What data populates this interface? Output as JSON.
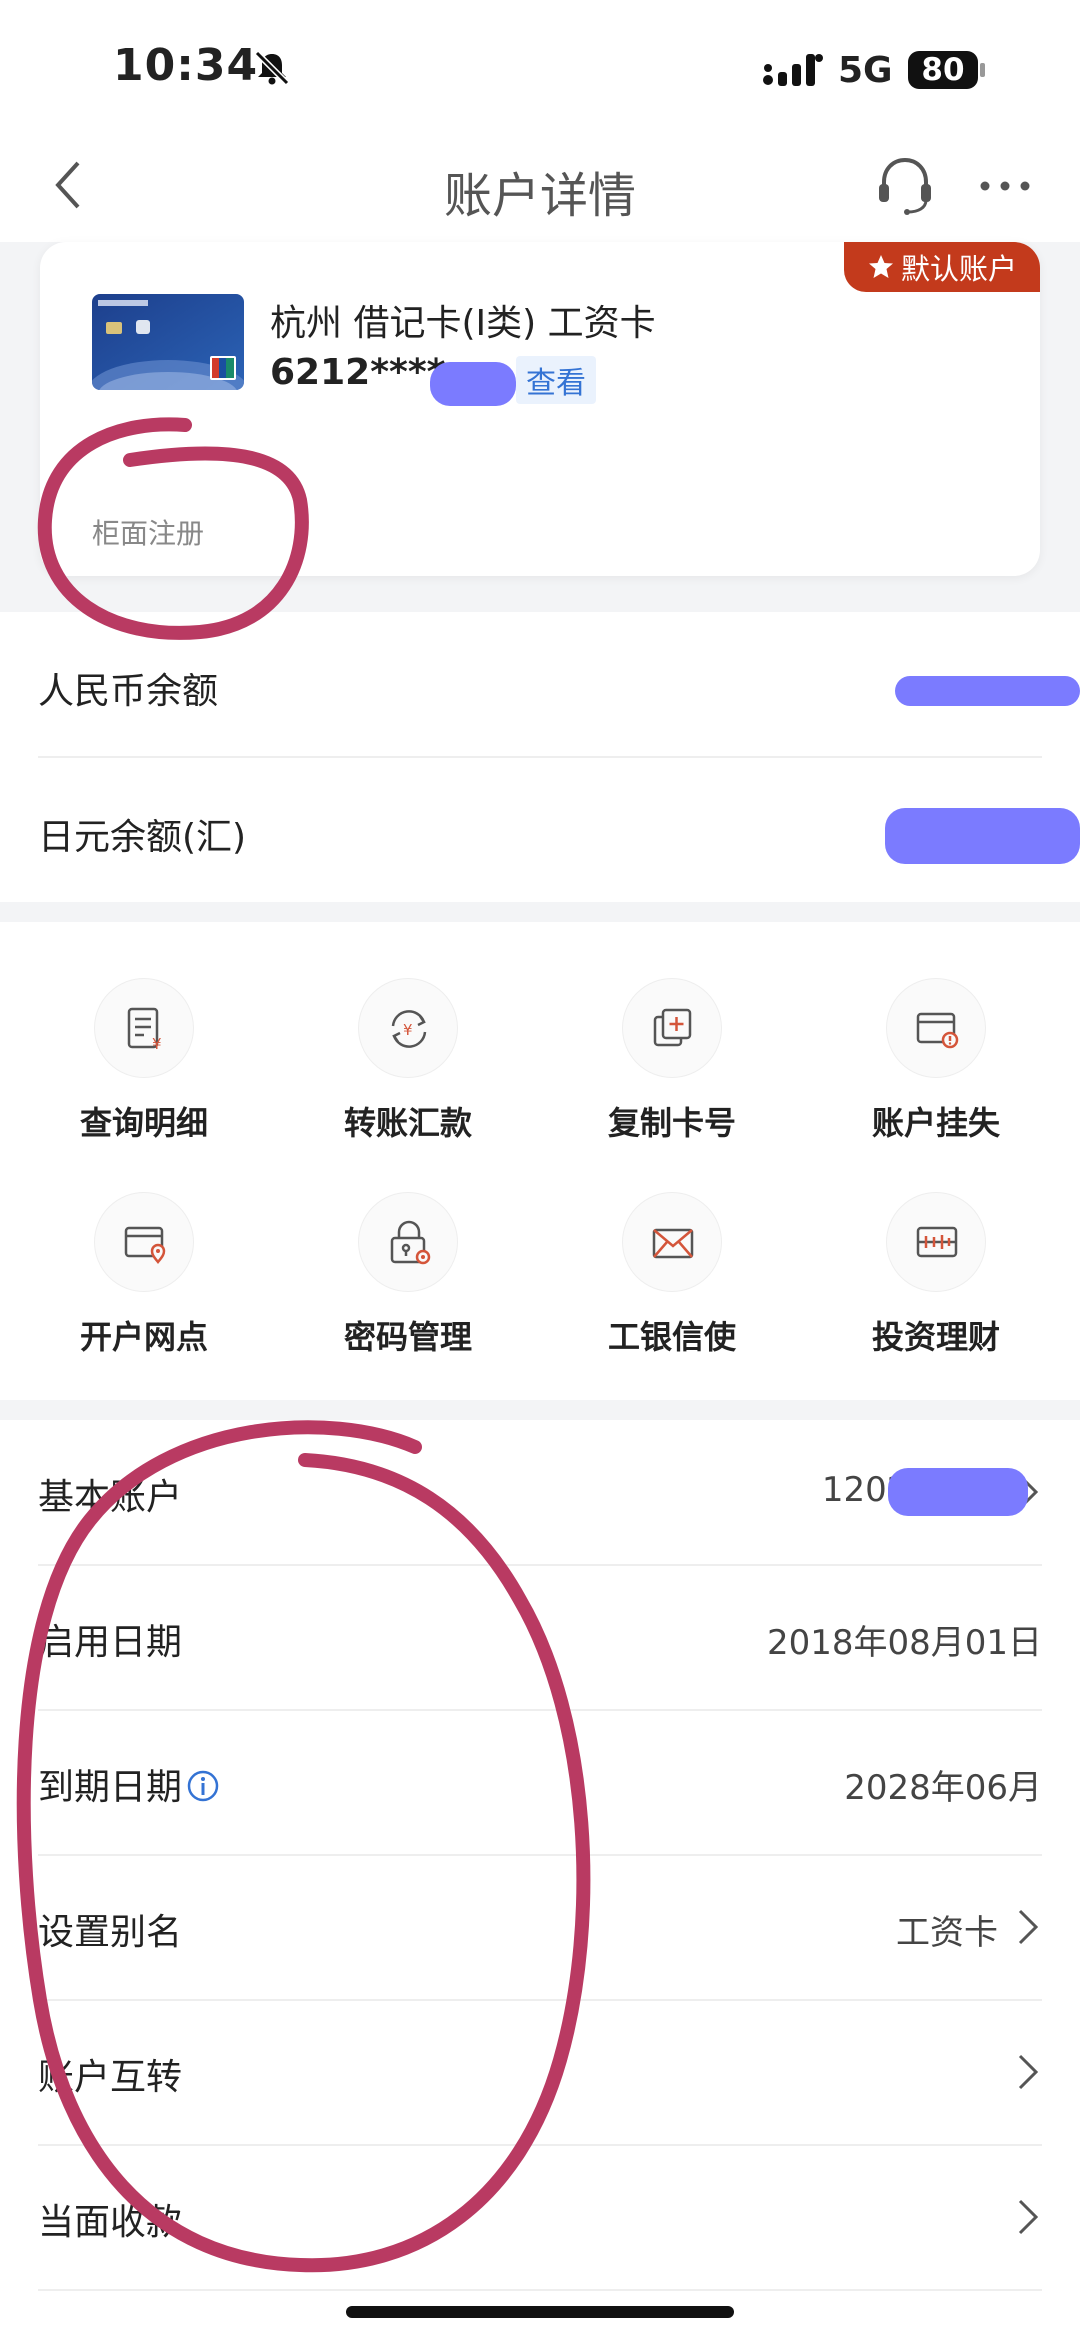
{
  "status_bar": {
    "time": "10:34",
    "network": "5G",
    "battery": "80"
  },
  "header": {
    "title": "账户详情"
  },
  "card": {
    "badge": "默认账户",
    "name": "杭州 借记卡(Ⅰ类) 工资卡",
    "number_masked": "6212****",
    "view_label": "查看",
    "registration": "柜面注册"
  },
  "balances": [
    {
      "label": "人民币余额"
    },
    {
      "label": "日元余额(汇)"
    }
  ],
  "actions": [
    {
      "label": "查询明细",
      "icon": "statement-icon"
    },
    {
      "label": "转账汇款",
      "icon": "transfer-icon"
    },
    {
      "label": "复制卡号",
      "icon": "copy-card-icon"
    },
    {
      "label": "账户挂失",
      "icon": "report-loss-icon"
    },
    {
      "label": "开户网点",
      "icon": "branch-location-icon"
    },
    {
      "label": "密码管理",
      "icon": "password-lock-icon"
    },
    {
      "label": "工银信使",
      "icon": "envelope-icon"
    },
    {
      "label": "投资理财",
      "icon": "investment-icon"
    }
  ],
  "list": [
    {
      "label": "基本账户",
      "value": "1202****3",
      "chevron": true
    },
    {
      "label": "启用日期",
      "value": "2018年08月01日",
      "chevron": false
    },
    {
      "label": "到期日期",
      "value": "2028年06月",
      "chevron": false,
      "info": true
    },
    {
      "label": "设置别名",
      "value": "工资卡",
      "chevron": true
    },
    {
      "label": "账户互转",
      "value": "",
      "chevron": true
    },
    {
      "label": "当面收款",
      "value": "",
      "chevron": true
    }
  ],
  "colors": {
    "badge": "#c33a1c",
    "link": "#3473d4",
    "action_icon_red": "#d4553a",
    "annotation_circle": "#b93a62",
    "redaction": "#7b7bff"
  }
}
